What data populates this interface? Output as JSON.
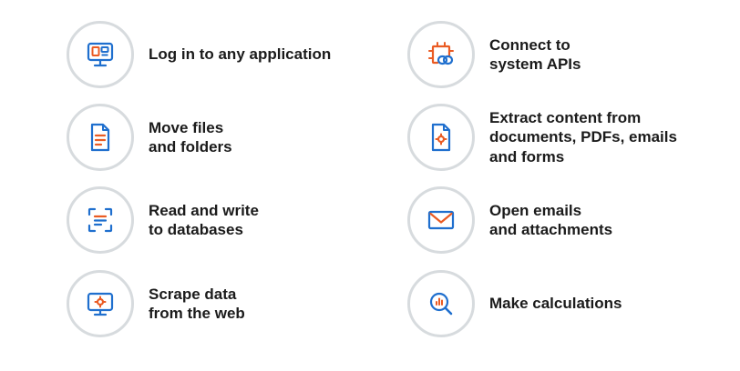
{
  "colors": {
    "blue": "#1f6fce",
    "orange": "#ea5b23",
    "circle_border": "#d7dbde",
    "text": "#1b1b1b"
  },
  "features": [
    {
      "icon": "computer-login-icon",
      "lines": [
        "Log in to any application"
      ]
    },
    {
      "icon": "document-icon",
      "lines": [
        "Move files",
        "and folders"
      ]
    },
    {
      "icon": "scan-text-icon",
      "lines": [
        "Read and write",
        "to databases"
      ]
    },
    {
      "icon": "monitor-gear-icon",
      "lines": [
        "Scrape data",
        "from the web"
      ]
    },
    {
      "icon": "chip-link-icon",
      "lines": [
        "Connect to",
        "system APIs"
      ]
    },
    {
      "icon": "document-gear-icon",
      "lines": [
        "Extract content from",
        "documents, PDFs, emails",
        "and forms"
      ]
    },
    {
      "icon": "envelope-icon",
      "lines": [
        "Open emails",
        "and attachments"
      ]
    },
    {
      "icon": "magnifier-chart-icon",
      "lines": [
        "Make calculations"
      ]
    }
  ]
}
